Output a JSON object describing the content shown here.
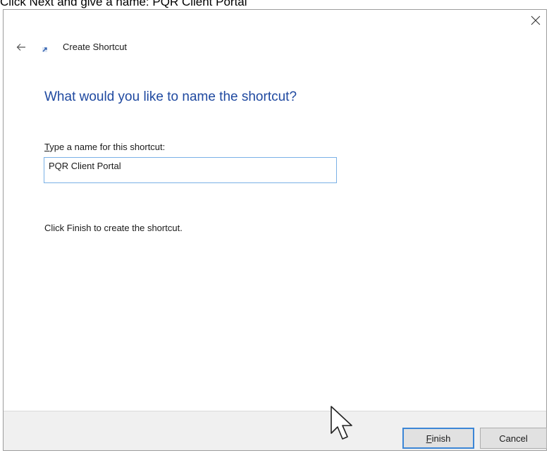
{
  "instruction": {
    "text": "Click Next and give a name: PQR Client Portal"
  },
  "window": {
    "close_icon": "close-icon",
    "back_icon": "back-arrow-icon",
    "title": "Create Shortcut"
  },
  "main": {
    "heading": "What would you like to name the shortcut?",
    "field_label_accesskey": "T",
    "field_label_rest": "ype a name for this shortcut:",
    "name_value": "PQR Client Portal",
    "hint": "Click Finish to create the shortcut."
  },
  "footer": {
    "finish_accesskey": "F",
    "finish_rest": "inish",
    "cancel_label": "Cancel"
  },
  "colors": {
    "heading": "#1f49a0",
    "input_border": "#7ab1e6",
    "default_button_border": "#3c86d6",
    "footer_bg": "#f0f0f0"
  }
}
